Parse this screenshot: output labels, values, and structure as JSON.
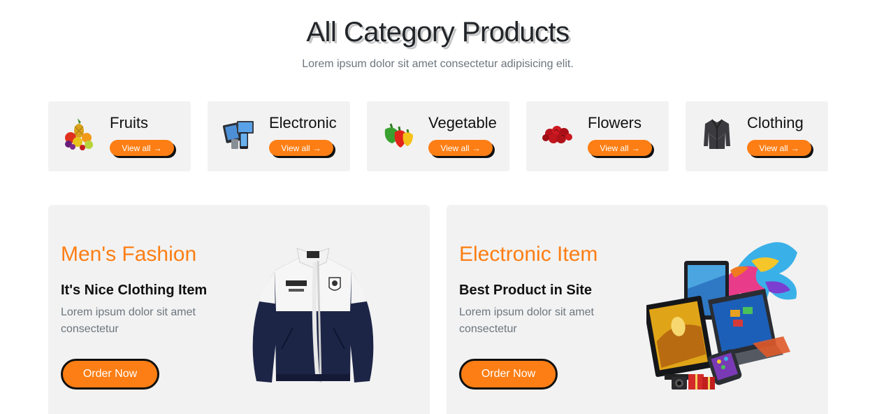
{
  "section": {
    "title": "All Category Products",
    "subtitle": "Lorem ipsum dolor sit amet consectetur adipisicing elit."
  },
  "categories": [
    {
      "name": "Fruits",
      "button": "View all",
      "icon": "fruits-icon"
    },
    {
      "name": "Electronic",
      "button": "View all",
      "icon": "electronics-icon"
    },
    {
      "name": "Vegetable",
      "button": "View all",
      "icon": "vegetable-icon"
    },
    {
      "name": "Flowers",
      "button": "View all",
      "icon": "flowers-icon"
    },
    {
      "name": "Clothing",
      "button": "View all",
      "icon": "clothing-icon"
    }
  ],
  "promos": [
    {
      "title": "Men's Fashion",
      "subtitle": "It's Nice Clothing Item",
      "description": "Lorem ipsum dolor sit amet consectetur",
      "button": "Order Now",
      "image": "jacket-image"
    },
    {
      "title": "Electronic Item",
      "subtitle": "Best Product in Site",
      "description": "Lorem ipsum dolor sit amet consectetur",
      "button": "Order Now",
      "image": "electronics-collage-image"
    }
  ],
  "colors": {
    "accent": "#fd7e14",
    "card_bg": "#f2f2f2",
    "text_dark": "#111111",
    "text_muted": "#6c757d"
  }
}
